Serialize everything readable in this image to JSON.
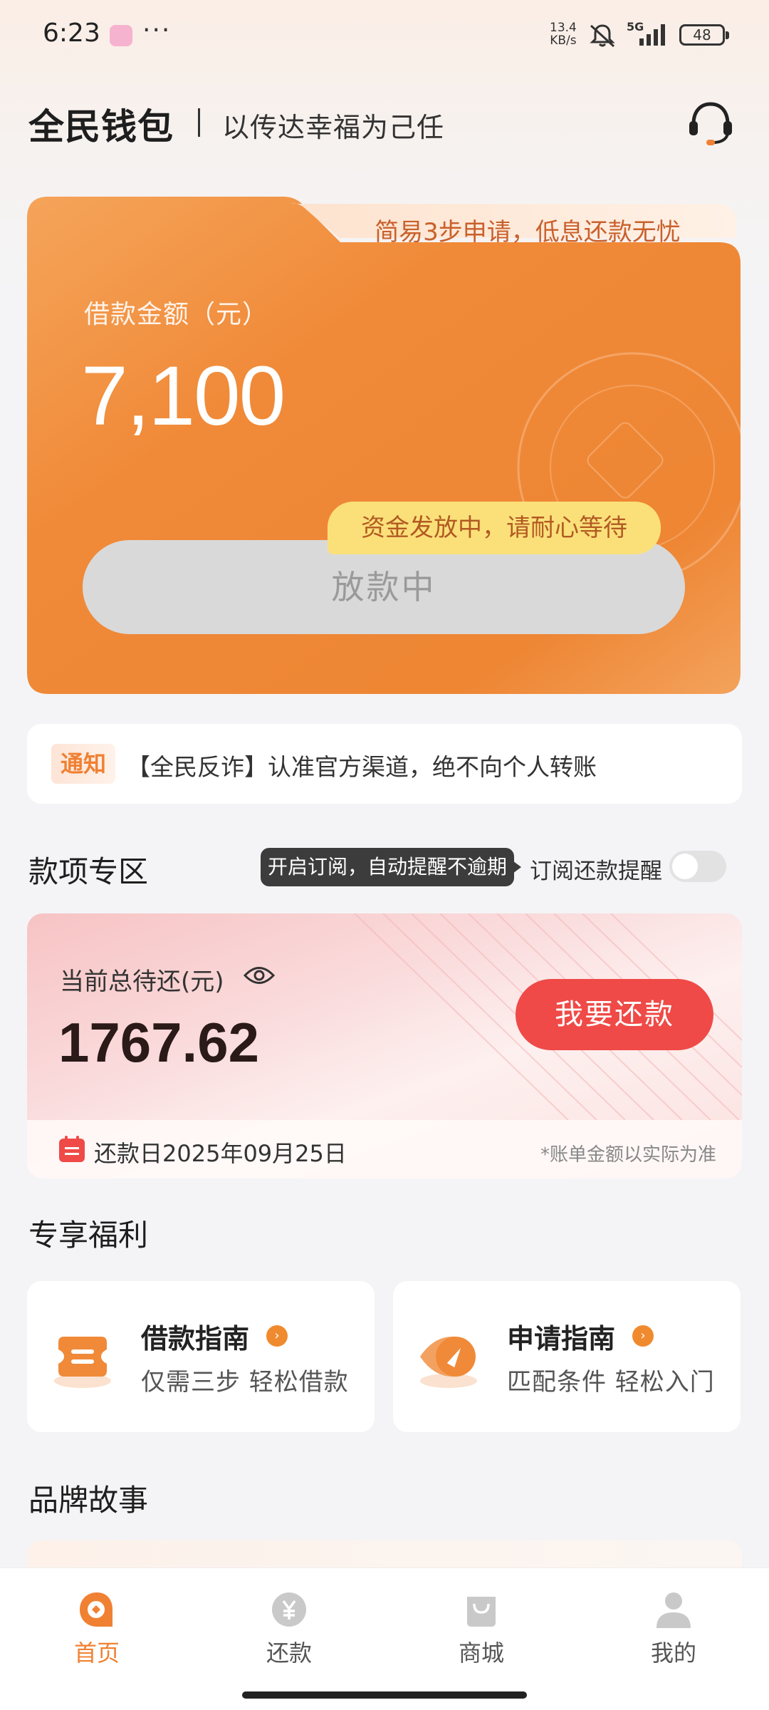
{
  "status_bar": {
    "time": "6:23",
    "dots": "···",
    "speed_top": "13.4",
    "speed_bottom": "KB/s",
    "network": "5G",
    "battery": "48"
  },
  "header": {
    "logo": "全民钱包",
    "slogan": "以传达幸福为己任",
    "support_icon": "headset-icon"
  },
  "loan_card": {
    "tagline": "简易3步申请，低息还款无忧",
    "label": "借款金额（元）",
    "amount": "7,100",
    "status_tip": "资金发放中，请耐心等待",
    "button_label": "放款中"
  },
  "notice": {
    "tag": "通知",
    "text": "【全民反诈】认准官方渠道，绝不向个人转账"
  },
  "repay_section": {
    "title": "款项专区",
    "tooltip": "开启订阅，自动提醒不逾期",
    "subscribe_label": "订阅还款提醒",
    "subscribe_on": false,
    "total_label": "当前总待还(元)",
    "total_amount": "1767.62",
    "repay_button": "我要还款",
    "due_date": "还款日2025年09月25日",
    "note": "*账单金额以实际为准"
  },
  "benefits": {
    "title": "专享福利",
    "items": [
      {
        "title": "借款指南",
        "subtitle": "仅需三步 轻松借款",
        "icon": "ticket-icon"
      },
      {
        "title": "申请指南",
        "subtitle": "匹配条件 轻松入门",
        "icon": "compass-icon"
      }
    ]
  },
  "brand_story": {
    "title": "品牌故事"
  },
  "bottom_nav": {
    "items": [
      {
        "label": "首页",
        "icon": "home-icon",
        "active": true
      },
      {
        "label": "还款",
        "icon": "yuan-icon",
        "active": false
      },
      {
        "label": "商城",
        "icon": "bag-icon",
        "active": false
      },
      {
        "label": "我的",
        "icon": "profile-icon",
        "active": false
      }
    ]
  },
  "colors": {
    "accent": "#f08133",
    "repay_button": "#ef4a47",
    "status_tip": "#fbe07a"
  }
}
